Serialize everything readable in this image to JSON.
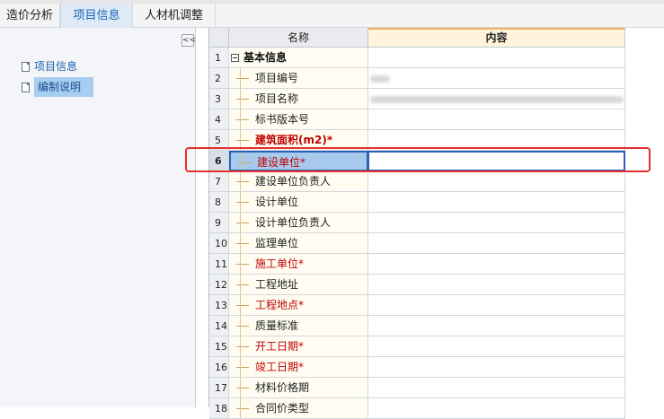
{
  "tabs": [
    {
      "label": "造价分析",
      "active": false
    },
    {
      "label": "项目信息",
      "active": true
    },
    {
      "label": "人材机调整",
      "active": false
    }
  ],
  "left_panel": {
    "collapse_label": "<<",
    "items": [
      {
        "label": "项目信息",
        "selected": false
      },
      {
        "label": "编制说明",
        "selected": true
      }
    ]
  },
  "grid": {
    "headers": {
      "name": "名称",
      "content": "内容"
    },
    "rows": [
      {
        "num": "1",
        "name": "基本信息",
        "style": "group",
        "value": ""
      },
      {
        "num": "2",
        "name": "项目编号",
        "style": "normal",
        "value": ""
      },
      {
        "num": "3",
        "name": "项目名称",
        "style": "normal",
        "value": ""
      },
      {
        "num": "4",
        "name": "标书版本号",
        "style": "normal",
        "value": ""
      },
      {
        "num": "5",
        "name": "建筑面积(m2)*",
        "style": "bold-required",
        "value": ""
      },
      {
        "num": "6",
        "name": "建设单位*",
        "style": "required",
        "value": "",
        "selected": true
      },
      {
        "num": "7",
        "name": "建设单位负责人",
        "style": "normal",
        "value": ""
      },
      {
        "num": "8",
        "name": "设计单位",
        "style": "normal",
        "value": ""
      },
      {
        "num": "9",
        "name": "设计单位负责人",
        "style": "normal",
        "value": ""
      },
      {
        "num": "10",
        "name": "监理单位",
        "style": "normal",
        "value": ""
      },
      {
        "num": "11",
        "name": "施工单位*",
        "style": "required",
        "value": ""
      },
      {
        "num": "12",
        "name": "工程地址",
        "style": "normal",
        "value": ""
      },
      {
        "num": "13",
        "name": "工程地点*",
        "style": "required",
        "value": ""
      },
      {
        "num": "14",
        "name": "质量标准",
        "style": "normal",
        "value": ""
      },
      {
        "num": "15",
        "name": "开工日期*",
        "style": "required",
        "value": ""
      },
      {
        "num": "16",
        "name": "竣工日期*",
        "style": "required",
        "value": ""
      },
      {
        "num": "17",
        "name": "材料价格期",
        "style": "normal",
        "value": ""
      },
      {
        "num": "18",
        "name": "合同价类型",
        "style": "normal",
        "value": ""
      }
    ]
  },
  "colors": {
    "accent": "#1a63b3",
    "required_text": "#c00000",
    "highlight_border": "#e2302e",
    "selection_fill": "#a7c9ec"
  }
}
